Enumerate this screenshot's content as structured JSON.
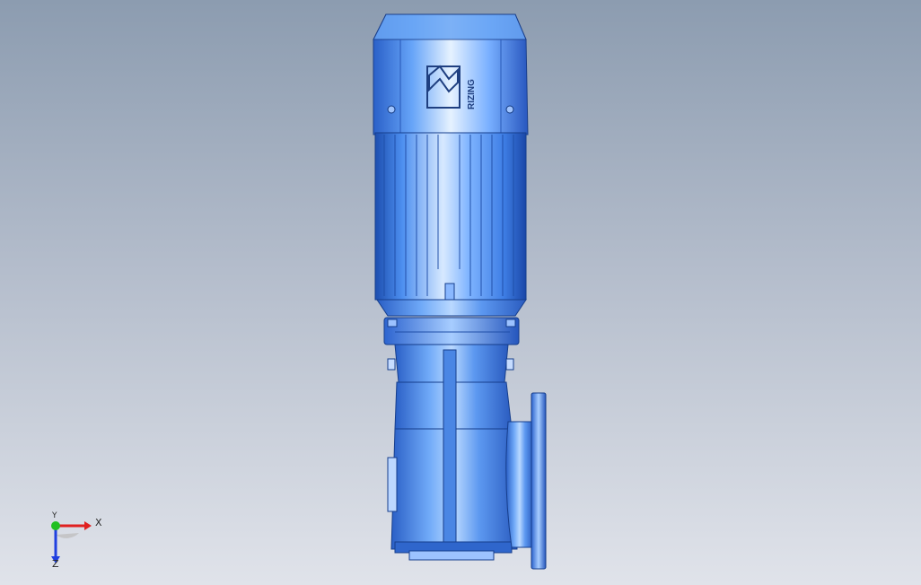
{
  "viewport": {
    "background_top": "#8c9cb0",
    "background_bottom": "#e0e3ea"
  },
  "model": {
    "name_label": "RIZING",
    "body_color": "#4f8ee8",
    "highlight_color": "#cfe4ff",
    "shadow_color": "#1f55b8"
  },
  "triad": {
    "x_label": "X",
    "y_label": "Y",
    "z_label": "Z",
    "x_color": "#e02020",
    "y_color": "#20c020",
    "z_color": "#2040e0"
  }
}
